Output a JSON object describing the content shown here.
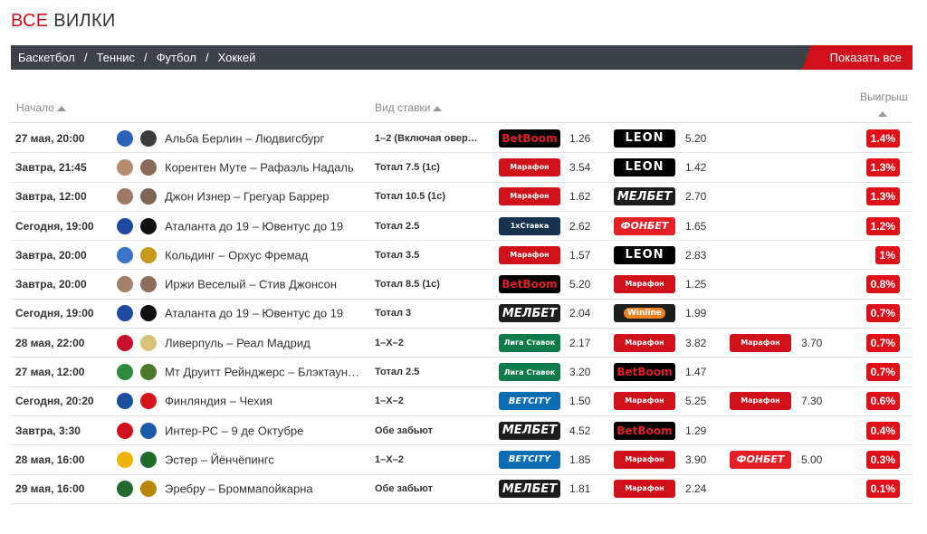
{
  "title": {
    "part1": "ВСЕ",
    "part2": "ВИЛКИ"
  },
  "sports": [
    "Баскетбол",
    "Теннис",
    "Футбол",
    "Хоккей"
  ],
  "show_all": "Показать все",
  "headers": {
    "start": "Начало",
    "bet_type": "Вид ставки",
    "profit": "Выигрыш"
  },
  "rows": [
    {
      "date": "27 мая, 20:00",
      "match": "Альба Берлин – Людвигсбург",
      "bet_type": "1–2 (Включая оверт…",
      "books": [
        {
          "name": "BetBoom",
          "odd": "1.26"
        },
        {
          "name": "LEON",
          "odd": "5.20"
        }
      ],
      "profit": "1.4%",
      "logo1_color": "#2a62b8",
      "logo2_color": "#3c3c3c"
    },
    {
      "date": "Завтра, 21:45",
      "match": "Корентен Муте – Рафаэль Надаль",
      "bet_type": "Тотал 7.5 (1с)",
      "books": [
        {
          "name": "Марафон",
          "odd": "3.54"
        },
        {
          "name": "LEON",
          "odd": "1.42"
        }
      ],
      "profit": "1.3%",
      "logo1_color": "#b58b6f",
      "logo2_color": "#8a6a58"
    },
    {
      "date": "Завтра, 12:00",
      "match": "Джон Изнер – Грегуар Баррер",
      "bet_type": "Тотал 10.5 (1с)",
      "books": [
        {
          "name": "Марафон",
          "odd": "1.62"
        },
        {
          "name": "МЕЛБЕТ",
          "odd": "2.70"
        }
      ],
      "profit": "1.3%",
      "logo1_color": "#9c7a64",
      "logo2_color": "#7e6556"
    },
    {
      "date": "Сегодня, 19:00",
      "match": "Аталанта до 19 – Ювентус до 19",
      "bet_type": "Тотал 2.5",
      "books": [
        {
          "name": "1хСтавка",
          "odd": "2.62"
        },
        {
          "name": "ФОНБЕТ",
          "odd": "1.65"
        }
      ],
      "profit": "1.2%",
      "logo1_color": "#1b4aa0",
      "logo2_color": "#111111"
    },
    {
      "date": "Завтра, 20:00",
      "match": "Кольдинг – Орхус Фремад",
      "bet_type": "Тотал 3.5",
      "books": [
        {
          "name": "Марафон",
          "odd": "1.57"
        },
        {
          "name": "LEON",
          "odd": "2.83"
        }
      ],
      "profit": "1%",
      "logo1_color": "#3b73c7",
      "logo2_color": "#c79a1a"
    },
    {
      "date": "Завтра, 20:00",
      "match": "Иржи Веселый – Стив Джонсон",
      "bet_type": "Тотал 8.5 (1с)",
      "books": [
        {
          "name": "BetBoom",
          "odd": "5.20"
        },
        {
          "name": "Марафон",
          "odd": "1.25"
        }
      ],
      "profit": "0.8%",
      "logo1_color": "#a2826d",
      "logo2_color": "#8c6e5c"
    },
    {
      "date": "Сегодня, 19:00",
      "match": "Аталанта до 19 – Ювентус до 19",
      "bet_type": "Тотал 3",
      "books": [
        {
          "name": "МЕЛБЕТ",
          "odd": "2.04"
        },
        {
          "name": "Winline",
          "odd": "1.99"
        }
      ],
      "profit": "0.7%",
      "logo1_color": "#1b4aa0",
      "logo2_color": "#111111"
    },
    {
      "date": "28 мая, 22:00",
      "match": "Ливерпуль – Реал Мадрид",
      "bet_type": "1–Х–2",
      "books": [
        {
          "name": "Лига Ставок",
          "odd": "2.17"
        },
        {
          "name": "Марафон",
          "odd": "3.82"
        },
        {
          "name": "Марафон",
          "odd": "3.70"
        }
      ],
      "profit": "0.7%",
      "logo1_color": "#c8102e",
      "logo2_color": "#d9c27a"
    },
    {
      "date": "27 мая, 12:00",
      "match": "Мт Друитт Рейнджерс – Блэктаун…",
      "bet_type": "Тотал 2.5",
      "books": [
        {
          "name": "Лига Ставок",
          "odd": "3.20"
        },
        {
          "name": "BetBoom",
          "odd": "1.47"
        }
      ],
      "profit": "0.7%",
      "logo1_color": "#2e8b3c",
      "logo2_color": "#4a7a2a"
    },
    {
      "date": "Сегодня, 20:20",
      "match": "Финляндия – Чехия",
      "bet_type": "1–Х–2",
      "books": [
        {
          "name": "BETCITY",
          "odd": "1.50"
        },
        {
          "name": "Марафон",
          "odd": "5.25"
        },
        {
          "name": "Марафон",
          "odd": "7.30"
        }
      ],
      "profit": "0.6%",
      "logo1_color": "#1a4fa0",
      "logo2_color": "#d7141a"
    },
    {
      "date": "Завтра, 3:30",
      "match": "Интер-РС – 9 де Октубре",
      "bet_type": "Обе забьют",
      "books": [
        {
          "name": "МЕЛБЕТ",
          "odd": "4.52"
        },
        {
          "name": "BetBoom",
          "odd": "1.29"
        }
      ],
      "profit": "0.4%",
      "logo1_color": "#d0101b",
      "logo2_color": "#1c5aa8"
    },
    {
      "date": "28 мая, 16:00",
      "match": "Эстер – Йёнчёпингс",
      "bet_type": "1–Х–2",
      "books": [
        {
          "name": "BETCITY",
          "odd": "1.85"
        },
        {
          "name": "Марафон",
          "odd": "3.90"
        },
        {
          "name": "ФОНБЕТ",
          "odd": "5.00"
        }
      ],
      "profit": "0.3%",
      "logo1_color": "#f0b400",
      "logo2_color": "#1f6b2c"
    },
    {
      "date": "29 мая, 16:00",
      "match": "Эребру – Броммапойкарна",
      "bet_type": "Обе забьют",
      "books": [
        {
          "name": "МЕЛБЕТ",
          "odd": "1.81"
        },
        {
          "name": "Марафон",
          "odd": "2.24"
        }
      ],
      "profit": "0.1%",
      "logo1_color": "#1f6b2c",
      "logo2_color": "#b8860b"
    }
  ]
}
